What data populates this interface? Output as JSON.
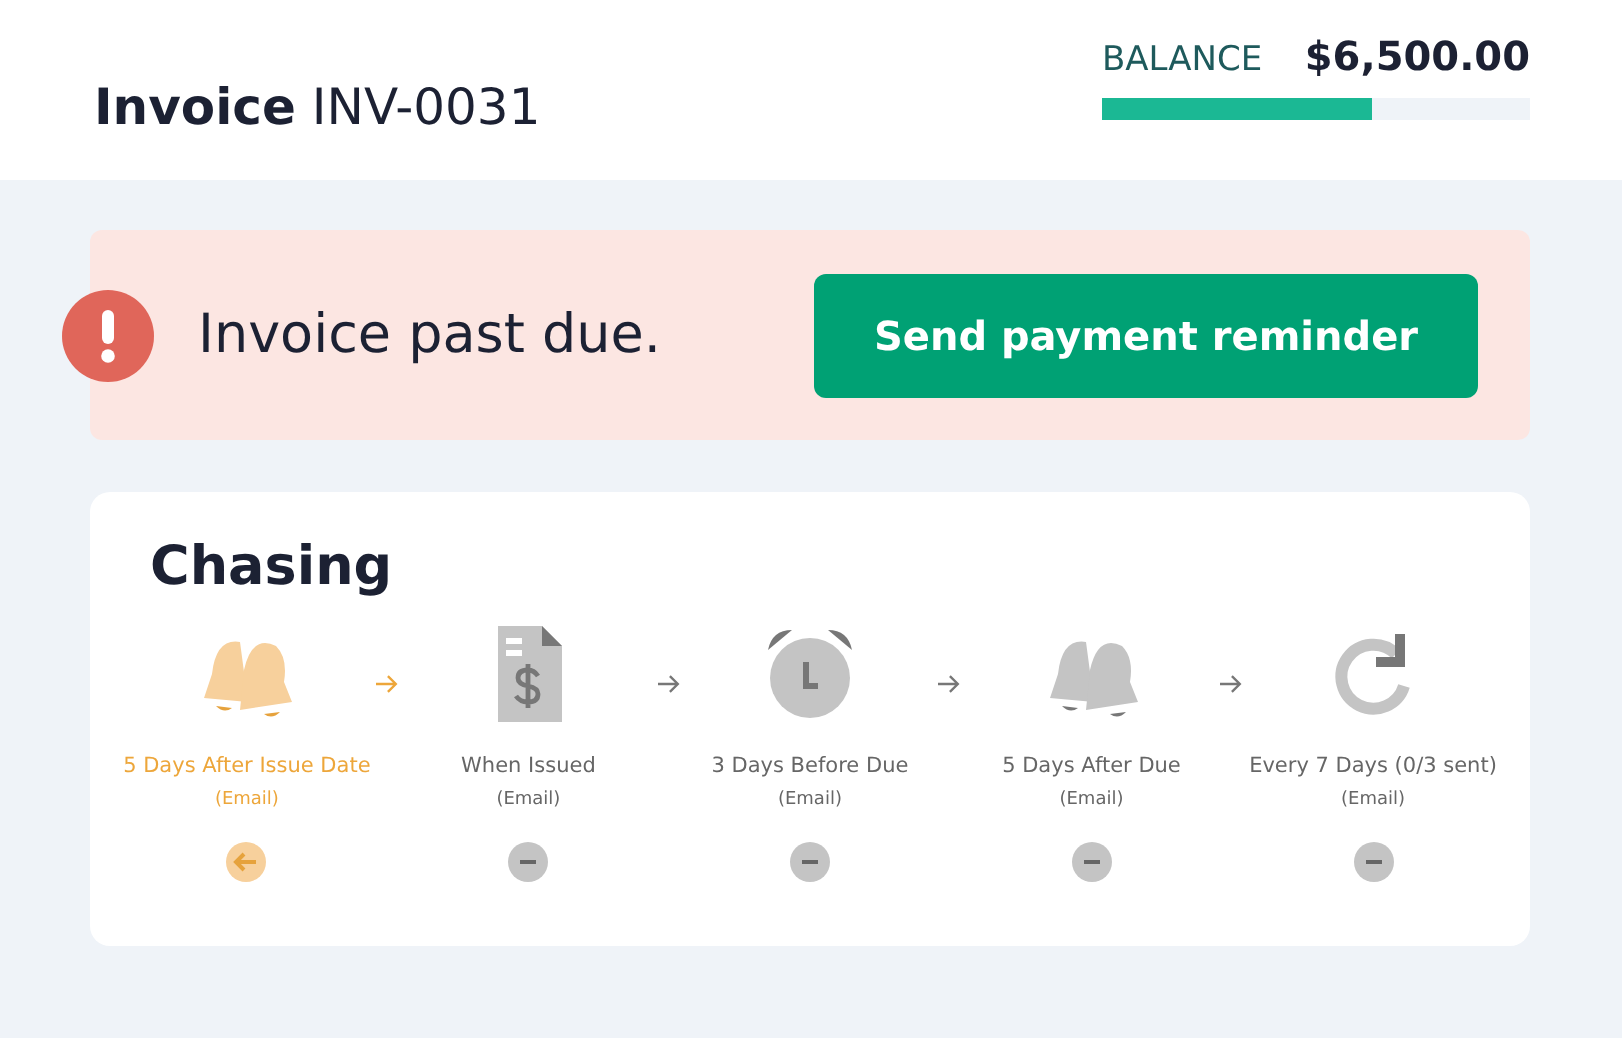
{
  "header": {
    "title": "Invoice",
    "number": "INV-0031",
    "balance_label": "BALANCE",
    "balance": "$6,500.00",
    "level": 0.63
  },
  "alert": {
    "message": "Invoice past due.",
    "button": "Send payment reminder"
  },
  "chasing": {
    "title": "Chasing",
    "steps": [
      {
        "kind": "bells",
        "label": "5 Days After Issue Date",
        "channel": "(Email)",
        "active": true
      },
      {
        "kind": "document",
        "label": "When Issued",
        "channel": "(Email)",
        "active": false
      },
      {
        "kind": "clock",
        "label": "3 Days Before Due",
        "channel": "(Email)",
        "active": false
      },
      {
        "kind": "bells",
        "label": "5 Days After Due",
        "channel": "(Email)",
        "active": false
      },
      {
        "kind": "repeat",
        "label": "Every 7 Days (0/3 sent)",
        "channel": "(Email)",
        "active": false
      }
    ]
  }
}
